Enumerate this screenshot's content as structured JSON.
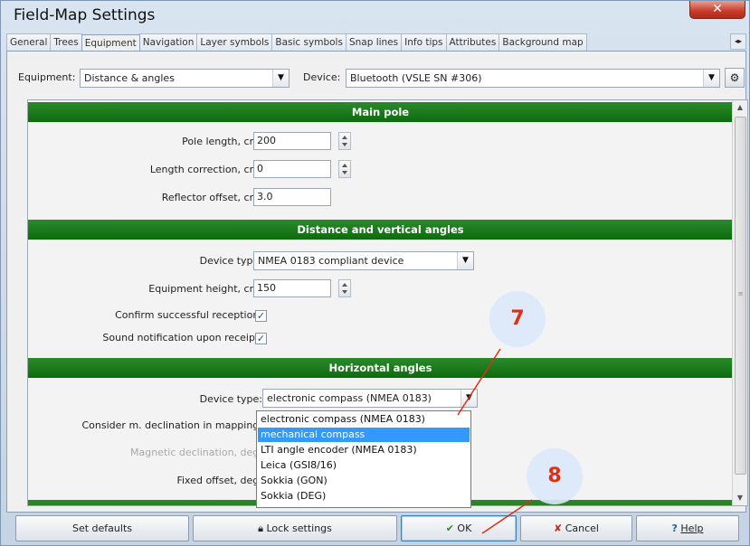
{
  "window": {
    "title": "Field-Map Settings",
    "close_glyph": "✕"
  },
  "tabs": [
    {
      "label": "General",
      "active": false
    },
    {
      "label": "Trees",
      "active": false
    },
    {
      "label": "Equipment",
      "active": true
    },
    {
      "label": "Navigation",
      "active": false
    },
    {
      "label": "Layer symbols",
      "active": false
    },
    {
      "label": "Basic symbols",
      "active": false
    },
    {
      "label": "Snap lines",
      "active": false
    },
    {
      "label": "Info tips",
      "active": false
    },
    {
      "label": "Attributes",
      "active": false
    },
    {
      "label": "Background map",
      "active": false
    }
  ],
  "equipment_row": {
    "equipment_label": "Equipment:",
    "equipment_value": "Distance & angles",
    "device_label": "Device:",
    "device_value": "Bluetooth (VSLE SN #306)"
  },
  "sections": {
    "main_pole": "Main pole",
    "distance": "Distance and vertical angles",
    "horizontal": "Horizontal angles"
  },
  "main_pole": {
    "pole_length_label": "Pole length, cm:",
    "pole_length_value": "200",
    "length_correction_label": "Length correction, cm:",
    "length_correction_value": "0",
    "reflector_offset_label": "Reflector offset, cm:",
    "reflector_offset_value": "3.0"
  },
  "distance": {
    "device_type_label": "Device type:",
    "device_type_value": "NMEA 0183 compliant device",
    "equipment_height_label": "Equipment height, cm:",
    "equipment_height_value": "150",
    "confirm_label": "Confirm successful reception:",
    "confirm_checked": true,
    "sound_label": "Sound notification upon receipt:",
    "sound_checked": true
  },
  "horizontal": {
    "device_type_label": "Device type:",
    "device_type_value": "electronic compass (NMEA 0183)",
    "consider_label": "Consider m. declination in mapping:",
    "magnetic_label": "Magnetic declination, deg:",
    "fixed_offset_label": "Fixed offset, deg:"
  },
  "dropdown_options": [
    "electronic compass (NMEA 0183)",
    "mechanical compass",
    "LTI angle encoder (NMEA 0183)",
    "Leica (GSI8/16)",
    "Sokkia (GON)",
    "Sokkia (DEG)"
  ],
  "dropdown_selected_index": 1,
  "buttons": {
    "set_defaults": "Set defaults",
    "lock_settings": "Lock settings",
    "ok": "OK",
    "cancel": "Cancel",
    "help": "Help"
  },
  "callouts": {
    "seven": "7",
    "eight": "8"
  },
  "colors": {
    "section_green": "#138013",
    "callout_text": "#e52d11",
    "selection_blue": "#3399ff"
  }
}
